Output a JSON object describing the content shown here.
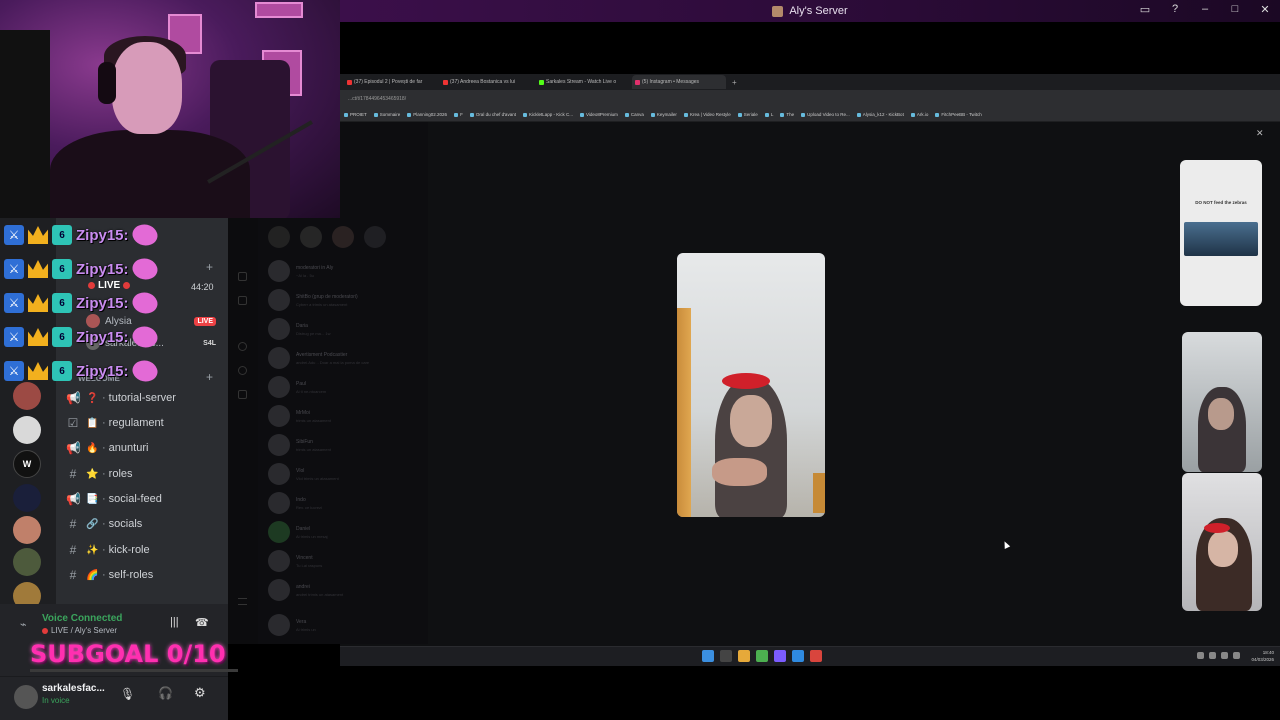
{
  "window": {
    "title": "Aly's Server"
  },
  "overlay": {
    "chat_user": "Zipy15:",
    "subgoal": "SUBGOAL 0/10"
  },
  "channel_panel": {
    "stream_time": "44:20",
    "live_label": "LIVE",
    "live_badge": "LIVE",
    "voice_users": [
      {
        "name": "Alysia"
      },
      {
        "name": "sarkalesfac...",
        "tag": "S4L"
      }
    ],
    "welcome_label": "WELCOME",
    "channels": [
      {
        "name": "tutorial-server",
        "emoji": "❓",
        "type": "announce"
      },
      {
        "name": "regulament",
        "emoji": "📋",
        "type": "rules"
      },
      {
        "name": "anunturi",
        "emoji": "🔥",
        "type": "announce"
      },
      {
        "name": "roles",
        "emoji": "⭐",
        "type": "text"
      },
      {
        "name": "social-feed",
        "emoji": "📑",
        "type": "announce"
      },
      {
        "name": "socials",
        "emoji": "🔗",
        "type": "text"
      },
      {
        "name": "kick-role",
        "emoji": "✨",
        "type": "text"
      },
      {
        "name": "self-roles",
        "emoji": "🌈",
        "type": "text"
      }
    ]
  },
  "voice_panel": {
    "status": "Voice Connected",
    "channel": "LIVE / Aly's Server"
  },
  "user_panel": {
    "username": "sarkalesfac...",
    "status": "In voice"
  },
  "browser": {
    "tabs": [
      {
        "label": "(37) Episodul 2 | Povești de far"
      },
      {
        "label": "(37) Andreea Bostanica vs lui"
      },
      {
        "label": "Sarkales Stream - Watch Live o"
      },
      {
        "label": "(5) Instagram • Messages"
      }
    ],
    "url": "...ct/t/1784496453465918/",
    "bookmarks": [
      "PROIET",
      "Sommaire",
      "Planning02.2026",
      "F",
      "Oral du chef d'avant",
      "KickletLapp - Kick C...",
      "Video8Premium",
      "Canva",
      "Keymailer",
      "Krea | Video Restyle",
      "Seriale",
      "L",
      "The",
      "Upload Video to Re...",
      "Alysia_k12 - KickBot",
      "Ark.io",
      "FitchPeeBB - Twitch"
    ]
  },
  "instagram": {
    "dms": [
      {
        "name": "moderatori in Aly",
        "msg": "~Ai la . 5u"
      },
      {
        "name": "ShitBo (grup de moderatori)",
        "msg": "Cyberr a trimis un atasament"
      },
      {
        "name": "Daria",
        "msg": "Distrug pe ma... 1w"
      },
      {
        "name": "Avertisment Podcastier",
        "msg": "andrei.Adu .. Doar a mai la poma de care"
      },
      {
        "name": "Paul",
        "msg": "Ai ti ne-ntoarcem"
      },
      {
        "name": "MrMoi",
        "msg": "trimis un atasament"
      },
      {
        "name": "SibiFun",
        "msg": "trimis un atasament"
      },
      {
        "name": "Vlol",
        "msg": "Vlol trimis un atasament"
      },
      {
        "name": "Indo",
        "msg": "Rev. ce lucrezi"
      },
      {
        "name": "Daniel",
        "msg": "Ai trimis un mesaj"
      },
      {
        "name": "Vincent",
        "msg": "Tu i-ai raspuns"
      },
      {
        "name": "andrei",
        "msg": "andrei trimis un atasament"
      },
      {
        "name": "Vera",
        "msg": "Ai trimis un"
      }
    ],
    "tile_text": "DO NOT feed the zebras"
  },
  "taskbar": {
    "time": "18:40",
    "date": "04/03/2026"
  }
}
